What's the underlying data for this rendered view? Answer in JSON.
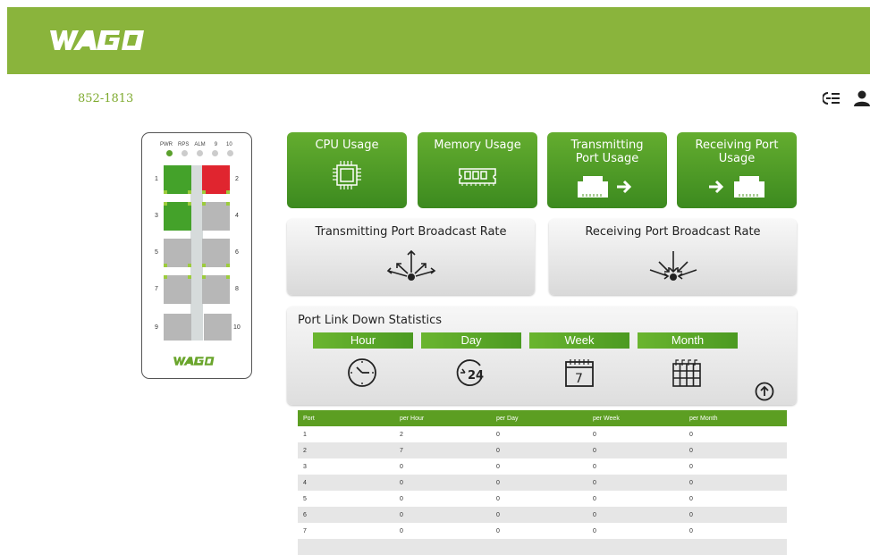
{
  "header": {
    "brand": "WAGO",
    "bg_color": "#8ab43c"
  },
  "model": "852-1813",
  "top_icons": [
    "list-menu-icon",
    "user-icon"
  ],
  "device": {
    "led_labels": [
      "PWR",
      "RPS",
      "ALM",
      "9",
      "10"
    ],
    "led_states": [
      "on",
      "off",
      "off",
      "off",
      "off"
    ],
    "port_numbers": [
      "1",
      "2",
      "3",
      "4",
      "5",
      "6",
      "7",
      "8",
      "9",
      "10"
    ],
    "port_states": {
      "1": "up",
      "2": "error",
      "3": "up",
      "4": "off",
      "5": "off",
      "6": "off",
      "7": "off",
      "8": "off",
      "9": "off",
      "10": "off"
    },
    "brand": "WAGO"
  },
  "tiles": {
    "cpu": "CPU Usage",
    "memory": "Memory Usage",
    "tx_port": "Transmitting Port Usage",
    "rx_port": "Receiving Port Usage",
    "tx_broadcast": "Transmitting Port Broadcast Rate",
    "rx_broadcast": "Receiving Port Broadcast Rate"
  },
  "stats": {
    "title": "Port Link Down Statistics",
    "periods": [
      "Hour",
      "Day",
      "Week",
      "Month"
    ],
    "day_icon_label": "24",
    "week_icon_label": "7"
  },
  "table": {
    "headers": [
      "Port",
      "per Hour",
      "per Day",
      "per Week",
      "per Month"
    ],
    "rows": [
      [
        "1",
        "2",
        "0",
        "0",
        "0"
      ],
      [
        "2",
        "7",
        "0",
        "0",
        "0"
      ],
      [
        "3",
        "0",
        "0",
        "0",
        "0"
      ],
      [
        "4",
        "0",
        "0",
        "0",
        "0"
      ],
      [
        "5",
        "0",
        "0",
        "0",
        "0"
      ],
      [
        "6",
        "0",
        "0",
        "0",
        "0"
      ],
      [
        "7",
        "0",
        "0",
        "0",
        "0"
      ]
    ]
  },
  "colors": {
    "accent": "#8ab43c",
    "tile_green": "#4c9a22",
    "port_error": "#e0252f"
  }
}
